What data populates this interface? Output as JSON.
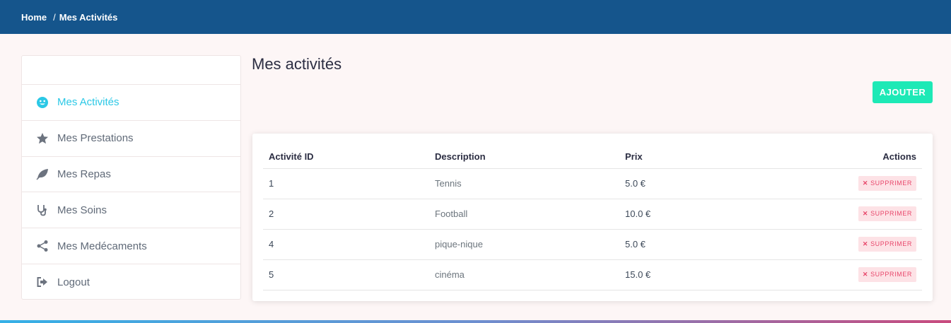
{
  "breadcrumb": {
    "home": "Home",
    "separator": "/",
    "current": "Mes Activités"
  },
  "sidebar": {
    "items": [
      {
        "label": "Mes Activités",
        "icon": "smile-icon",
        "active": true
      },
      {
        "label": "Mes Prestations",
        "icon": "star-icon",
        "active": false
      },
      {
        "label": "Mes Repas",
        "icon": "leaf-icon",
        "active": false
      },
      {
        "label": "Mes Soins",
        "icon": "stethoscope-icon",
        "active": false
      },
      {
        "label": "Mes Medécaments",
        "icon": "share-icon",
        "active": false
      },
      {
        "label": "Logout",
        "icon": "logout-icon",
        "active": false
      }
    ]
  },
  "page": {
    "title": "Mes activités",
    "add_label": "AJOUTER"
  },
  "table": {
    "headers": [
      "Activité ID",
      "Description",
      "Prix",
      "Actions"
    ],
    "rows": [
      {
        "id": "1",
        "description": "Tennis",
        "prix": "5.0 €",
        "action": "SUPPRIMER"
      },
      {
        "id": "2",
        "description": "Football",
        "prix": "10.0 €",
        "action": "SUPPRIMER"
      },
      {
        "id": "4",
        "description": "pique-nique",
        "prix": "5.0 €",
        "action": "SUPPRIMER"
      },
      {
        "id": "5",
        "description": "cinéma",
        "prix": "15.0 €",
        "action": "SUPPRIMER"
      }
    ]
  },
  "colors": {
    "header": "#15558c",
    "active": "#2bc8e6",
    "add_button": "#1de9b6",
    "delete": "#e8466a"
  }
}
